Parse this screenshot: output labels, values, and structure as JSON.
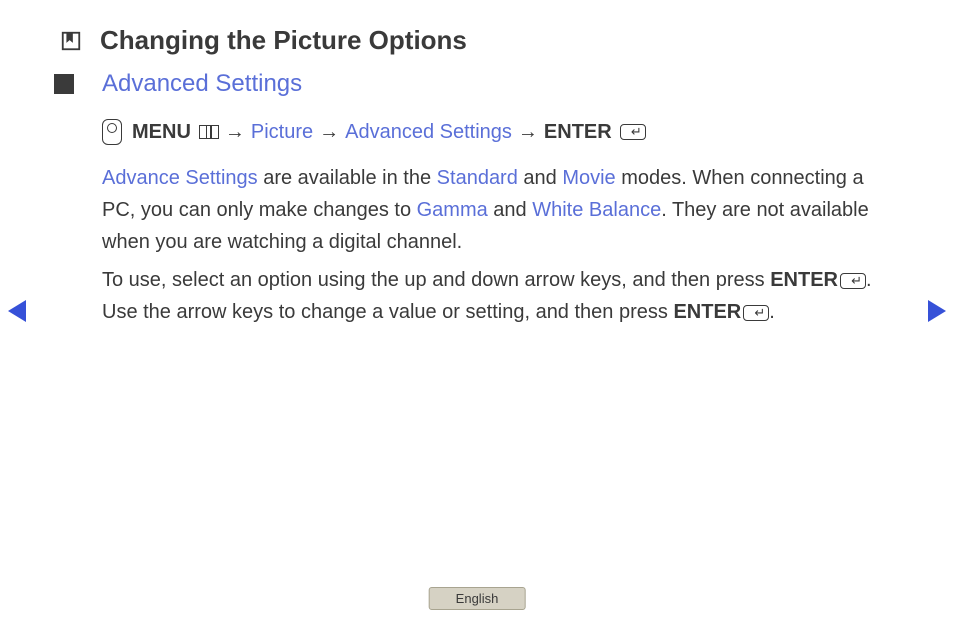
{
  "header": {
    "title": "Changing the Picture Options"
  },
  "section": {
    "title": "Advanced Settings"
  },
  "nav": {
    "menu_label": "MENU",
    "arrow": "→",
    "picture": "Picture",
    "advanced_settings": "Advanced Settings",
    "enter_label": "ENTER"
  },
  "body": {
    "p1_lead": "Advance Settings",
    "p1_part1": " are available in the ",
    "p1_standard": "Standard",
    "p1_and": " and ",
    "p1_movie": "Movie",
    "p1_part2": " modes. When connecting a PC, you can only make changes to ",
    "p1_gamma": "Gamma",
    "p1_and2": " and ",
    "p1_wb": "White Balance",
    "p1_part3": ". They are not available when you are watching a digital channel.",
    "p2_part1": "To use, select an option using the up and down arrow keys, and then press ",
    "p2_enter1": "ENTER",
    "p2_part2": ". Use the arrow keys to change a value or setting, and then press ",
    "p2_enter2": "ENTER",
    "p2_part3": "."
  },
  "footer": {
    "language": "English"
  }
}
